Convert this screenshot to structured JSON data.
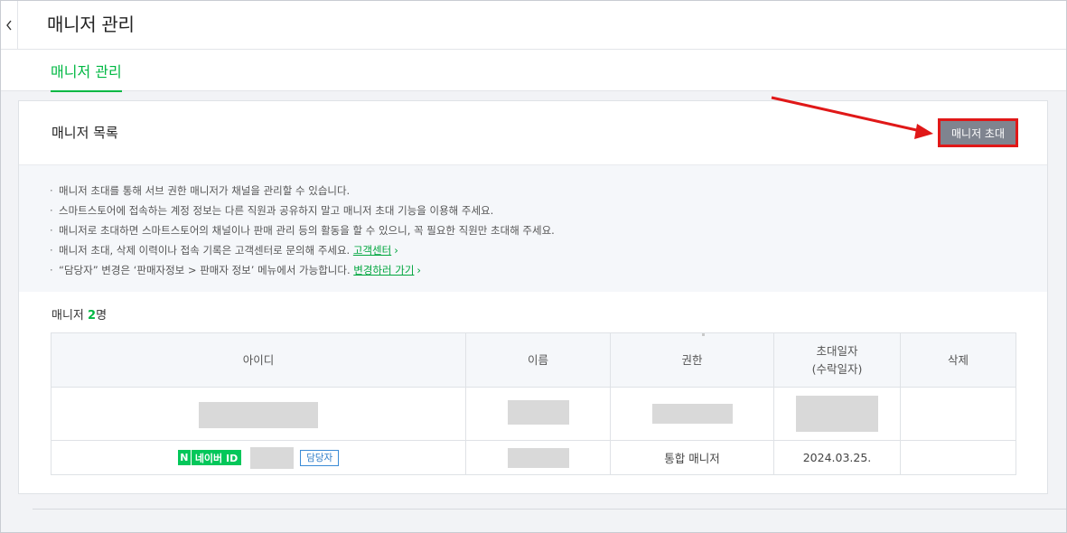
{
  "header": {
    "title": "매니저 관리",
    "back_icon": "chevron-left-icon"
  },
  "tabs": [
    {
      "label": "매니저 관리",
      "active": true
    }
  ],
  "card": {
    "title": "매니저 목록",
    "invite_button": "매니저 초대"
  },
  "notice": {
    "items": [
      {
        "text": "매니저 초대를 통해 서브 권한 매니저가 채널을 관리할 수 있습니다."
      },
      {
        "text": "스마트스토어에 접속하는 계정 정보는 다른 직원과 공유하지 말고 매니저 초대 기능을 이용해 주세요."
      },
      {
        "text": "매니저로 초대하면 스마트스토어의 채널이나 판매 관리 등의 활동을 할 수 있으니, 꼭 필요한 직원만 초대해 주세요."
      },
      {
        "text": "매니저 초대, 삭제 이력이나 접속 기록은 고객센터로 문의해 주세요. ",
        "link": "고객센터"
      },
      {
        "text": "“담당자” 변경은 ‘판매자정보 > 판매자 정보’ 메뉴에서 가능합니다. ",
        "link": "변경하러 가기"
      }
    ],
    "bullet": "·",
    "link_arrow": "›"
  },
  "count": {
    "label": "매니저 ",
    "value": "2",
    "unit": "명"
  },
  "table": {
    "headers": {
      "id": "아이디",
      "name": "이름",
      "role": "권한",
      "date_line1": "초대일자",
      "date_line2": "(수락일자)",
      "delete": "삭제"
    },
    "rows": [
      {
        "id": "",
        "name": "",
        "role": "",
        "date": ""
      },
      {
        "badge_n": "N",
        "badge_text": "네이버 ID",
        "tag": "담당자",
        "role": "통합 매니저",
        "date": "2024.03.25."
      }
    ]
  },
  "colors": {
    "accent": "#00b843",
    "naver": "#03c75a",
    "button": "#7f848f",
    "highlight": "#e01818"
  }
}
